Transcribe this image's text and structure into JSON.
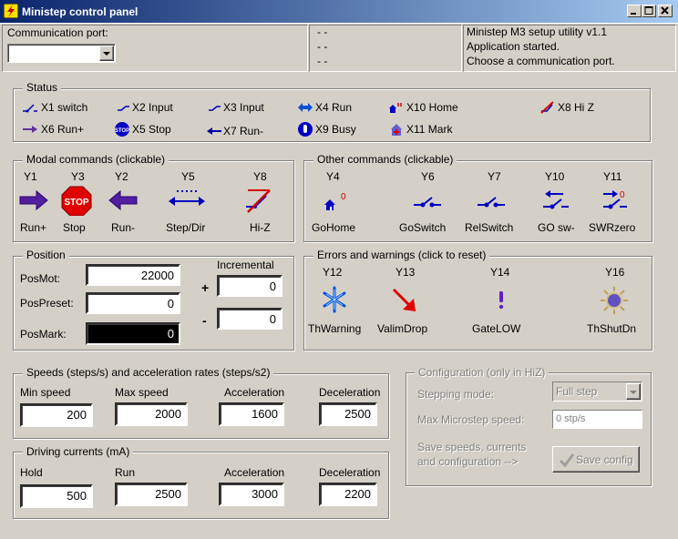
{
  "window": {
    "title": "Ministep control panel"
  },
  "comm": {
    "label": "Communication port:",
    "value": ""
  },
  "status_lines": [
    "- -",
    "- -",
    "- -"
  ],
  "log_lines": [
    "Ministep M3 setup utility v1.1",
    "Application started.",
    "Choose a communication port."
  ],
  "status": {
    "title": "Status",
    "items": [
      {
        "label": "X1 switch",
        "icon": "switch-icon"
      },
      {
        "label": "X2 Input",
        "icon": "input-icon"
      },
      {
        "label": "X3 Input",
        "icon": "input-icon"
      },
      {
        "label": "X4 Run",
        "icon": "run-arrows-icon"
      },
      {
        "label": "X10 Home",
        "icon": "home-icon"
      },
      {
        "label": "X8 Hi Z",
        "icon": "hiz-icon"
      },
      {
        "label": "X6 Run+",
        "icon": "arrow-right-icon"
      },
      {
        "label": "X5 Stop",
        "icon": "stop-icon"
      },
      {
        "label": "X7 Run-",
        "icon": "arrow-left-icon"
      },
      {
        "label": "X9 Busy",
        "icon": "busy-icon"
      },
      {
        "label": "X11 Mark",
        "icon": "mark-icon"
      }
    ]
  },
  "modal": {
    "title": "Modal commands (clickable)",
    "items": [
      {
        "code": "Y1",
        "label": "Run+"
      },
      {
        "code": "Y3",
        "label": "Stop"
      },
      {
        "code": "Y2",
        "label": "Run-"
      },
      {
        "code": "Y5",
        "label": "Step/Dir"
      },
      {
        "code": "Y8",
        "label": "Hi-Z"
      }
    ]
  },
  "other": {
    "title": "Other commands (clickable)",
    "items": [
      {
        "code": "Y4",
        "label": "GoHome"
      },
      {
        "code": "Y6",
        "label": "GoSwitch"
      },
      {
        "code": "Y7",
        "label": "RelSwitch"
      },
      {
        "code": "Y10",
        "label": "GO sw-"
      },
      {
        "code": "Y11",
        "label": "SWRzero"
      }
    ]
  },
  "position": {
    "title": "Position",
    "posmot_label": "PosMot:",
    "posmot": "22000",
    "pospreset_label": "PosPreset:",
    "pospreset": "0",
    "posmark_label": "PosMark:",
    "posmark": "0",
    "incremental_label": "Incremental",
    "inc_plus": "0",
    "inc_minus": "0",
    "plus_sign": "+",
    "minus_sign": "-"
  },
  "errors": {
    "title": "Errors and warnings (click to reset)",
    "items": [
      {
        "code": "Y12",
        "label": "ThWarning"
      },
      {
        "code": "Y13",
        "label": "ValimDrop"
      },
      {
        "code": "Y14",
        "label": "GateLOW"
      },
      {
        "code": "Y16",
        "label": "ThShutDn"
      }
    ]
  },
  "speeds": {
    "title": "Speeds (steps/s) and acceleration rates (steps/s2)",
    "min_label": "Min speed",
    "min": "200",
    "max_label": "Max speed",
    "max": "2000",
    "acc_label": "Acceleration",
    "acc": "1600",
    "dec_label": "Deceleration",
    "dec": "2500"
  },
  "currents": {
    "title": "Driving currents (mA)",
    "hold_label": "Hold",
    "hold": "500",
    "run_label": "Run",
    "run": "2500",
    "acc_label": "Acceleration",
    "acc": "3000",
    "dec_label": "Deceleration",
    "dec": "2200"
  },
  "config": {
    "title": "Configuration (only in HiZ)",
    "stepping_label": "Stepping mode:",
    "stepping_value": "Full step",
    "microstep_label": "Max Microstep speed:",
    "microstep_value": "0 stp/s",
    "save_text_1": "Save speeds, currents",
    "save_text_2": "and configuration -->",
    "save_button": "Save config"
  }
}
